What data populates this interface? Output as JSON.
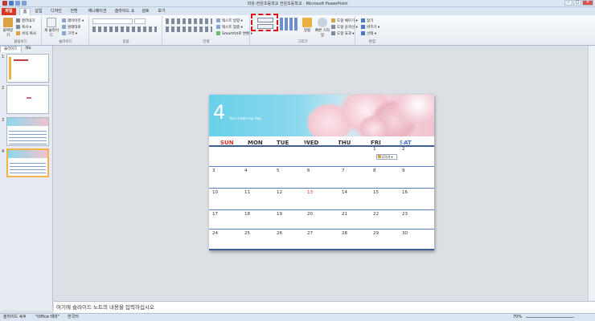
{
  "window": {
    "title": "미완-전원초등학교 전원초등학교 - Microsoft PowerPoint",
    "min": "–",
    "max": "□",
    "close": "✕"
  },
  "tabs": [
    "파일",
    "홈",
    "삽입",
    "디자인",
    "전환",
    "애니메이션",
    "슬라이드 쇼",
    "검토",
    "보기"
  ],
  "ribbon": {
    "clipboard": {
      "paste": "붙여넣기",
      "cut": "잘라내기",
      "copy": "복사 ▾",
      "format": "서식 복사",
      "label": "클립보드"
    },
    "slides": {
      "new": "새 슬라이드",
      "layout": "레이아웃 ▾",
      "reset": "원래대로",
      "section": "구역 ▾",
      "label": "슬라이드"
    },
    "font": {
      "label": "글꼴"
    },
    "paragraph": {
      "direction": "텍스트 방향 ▾",
      "align": "텍스트 맞춤 ▾",
      "smartart": "SmartArt로 변환 ▾",
      "label": "단락"
    },
    "drawing": {
      "arrange": "정렬",
      "quick_styles": "빠른 스타일",
      "fill": "도형 채우기 ▾",
      "outline": "도형 윤곽선 ▾",
      "effects": "도형 효과 ▾",
      "label": "그리기"
    },
    "editing": {
      "find": "찾기",
      "replace": "바꾸기 ▾",
      "select": "선택 ▾",
      "label": "편집"
    }
  },
  "panel": {
    "tab_slides": "슬라이드",
    "tab_outline": "개요",
    "thumbs": [
      "1",
      "2",
      "3",
      "4"
    ]
  },
  "calendar": {
    "month": "4",
    "subtitle": "You made my day",
    "days": [
      "SUN",
      "MON",
      "TUE",
      "WED",
      "THU",
      "FRI",
      "SAT"
    ],
    "day_colors": [
      "#d8302f",
      "#333333",
      "#333333",
      "#333333",
      "#333333",
      "#333333",
      "#4a74c4"
    ],
    "weeks": [
      [
        "",
        "",
        "",
        "",
        "",
        "1",
        "2"
      ],
      [
        "3",
        "4",
        "5",
        "6",
        "7",
        "8",
        "9"
      ],
      [
        "10",
        "11",
        "12",
        "13",
        "14",
        "15",
        "16"
      ],
      [
        "17",
        "18",
        "19",
        "20",
        "21",
        "22",
        "23"
      ],
      [
        "24",
        "25",
        "26",
        "27",
        "28",
        "29",
        "30"
      ]
    ],
    "holiday": "13"
  },
  "paste_options": "(Ctrl) ▾",
  "notes_placeholder": "여기에 슬라이드 노트의 내용을 입력하십시오",
  "status": {
    "slide": "슬라이드 4/4",
    "theme": "\"Office 테마\"",
    "lang": "한국어",
    "zoom": "70%"
  }
}
